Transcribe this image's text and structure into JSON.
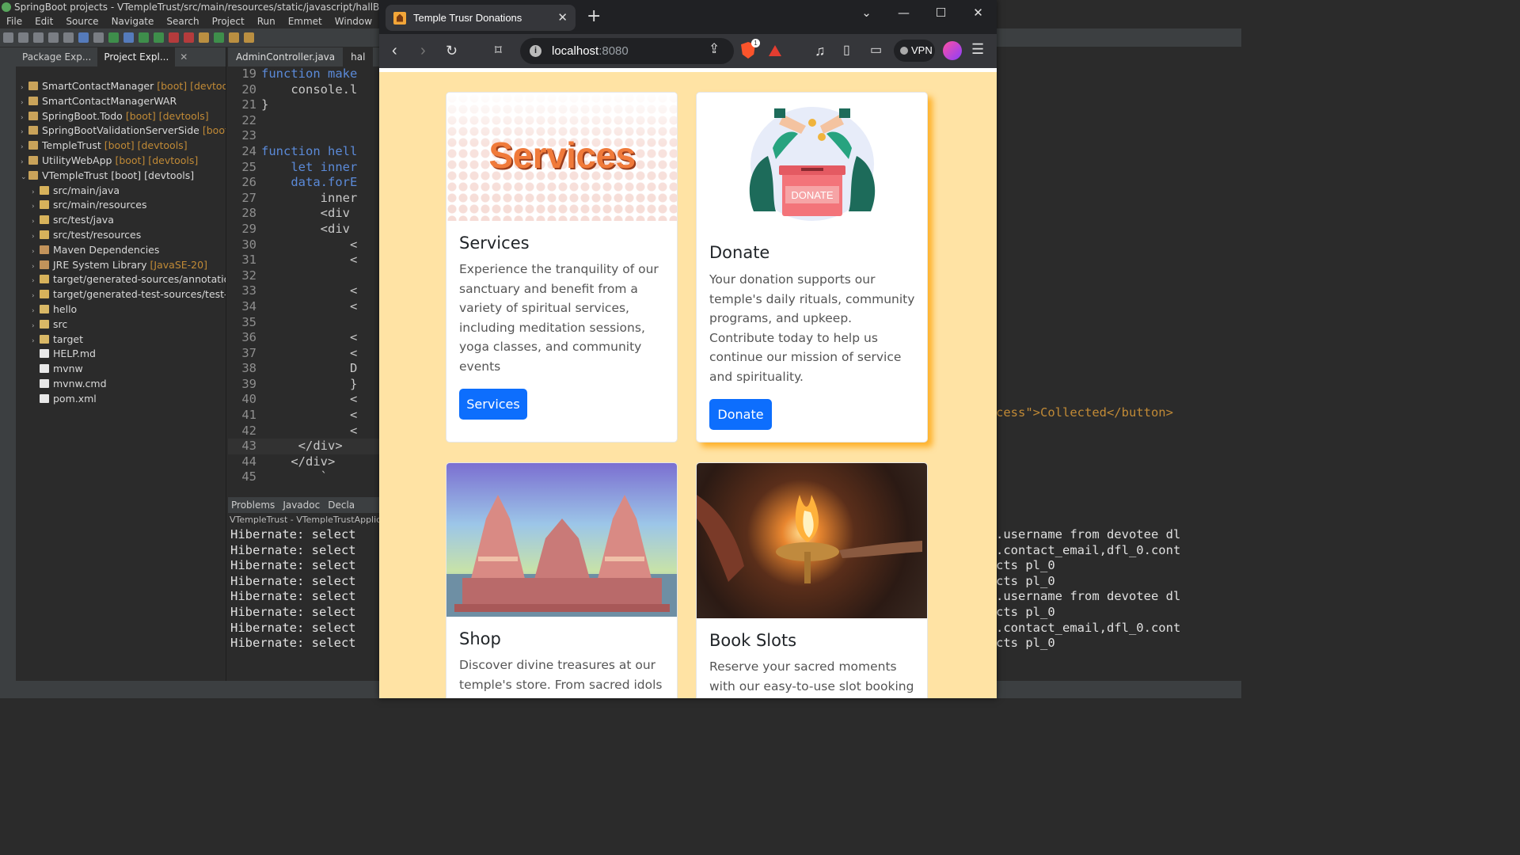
{
  "ide": {
    "title": "SpringBoot projects - VTempleTrust/src/main/resources/static/javascript/hallBooking.js - Sp",
    "menu": [
      "File",
      "Edit",
      "Source",
      "Navigate",
      "Search",
      "Project",
      "Run",
      "Emmet",
      "Window",
      "Help"
    ],
    "explorer_tabs": [
      "Package Exp...",
      "Project Expl..."
    ],
    "tree": [
      {
        "label": "SmartContactManager",
        "dec": "[boot] [devtools]",
        "depth": 0,
        "icon": "proj",
        "arrow": "›"
      },
      {
        "label": "SmartContactManagerWAR",
        "dec": "",
        "depth": 0,
        "icon": "proj",
        "arrow": "›"
      },
      {
        "label": "SpringBoot.Todo",
        "dec": "[boot] [devtools]",
        "depth": 0,
        "icon": "proj",
        "arrow": "›"
      },
      {
        "label": "SpringBootValidationServerSide",
        "dec": "[boot] [de",
        "depth": 0,
        "icon": "proj",
        "arrow": "›"
      },
      {
        "label": "TempleTrust",
        "dec": "[boot] [devtools]",
        "depth": 0,
        "icon": "proj",
        "arrow": "›"
      },
      {
        "label": "UtilityWebApp",
        "dec": "[boot] [devtools]",
        "depth": 0,
        "icon": "proj",
        "arrow": "›"
      },
      {
        "label": "VTempleTrust [boot] [devtools]",
        "dec": "",
        "depth": 0,
        "icon": "proj",
        "arrow": "⌄"
      },
      {
        "label": "src/main/java",
        "dec": "",
        "depth": 1,
        "icon": "pkg",
        "arrow": "›"
      },
      {
        "label": "src/main/resources",
        "dec": "",
        "depth": 1,
        "icon": "pkg",
        "arrow": "›"
      },
      {
        "label": "src/test/java",
        "dec": "",
        "depth": 1,
        "icon": "pkg",
        "arrow": "›"
      },
      {
        "label": "src/test/resources",
        "dec": "",
        "depth": 1,
        "icon": "pkg",
        "arrow": "›"
      },
      {
        "label": "Maven Dependencies",
        "dec": "",
        "depth": 1,
        "icon": "lib",
        "arrow": "›"
      },
      {
        "label": "JRE System Library",
        "dec": "[JavaSE-20]",
        "depth": 1,
        "icon": "lib",
        "arrow": "›"
      },
      {
        "label": "target/generated-sources/annotations",
        "dec": "",
        "depth": 1,
        "icon": "pkg",
        "arrow": "›"
      },
      {
        "label": "target/generated-test-sources/test-anno",
        "dec": "",
        "depth": 1,
        "icon": "pkg",
        "arrow": "›"
      },
      {
        "label": "hello",
        "dec": "",
        "depth": 1,
        "icon": "fld",
        "arrow": "›"
      },
      {
        "label": "src",
        "dec": "",
        "depth": 1,
        "icon": "fld",
        "arrow": "›"
      },
      {
        "label": "target",
        "dec": "",
        "depth": 1,
        "icon": "fld",
        "arrow": "›"
      },
      {
        "label": "HELP.md",
        "dec": "",
        "depth": 1,
        "icon": "file",
        "arrow": ""
      },
      {
        "label": "mvnw",
        "dec": "",
        "depth": 1,
        "icon": "file",
        "arrow": ""
      },
      {
        "label": "mvnw.cmd",
        "dec": "",
        "depth": 1,
        "icon": "file",
        "arrow": ""
      },
      {
        "label": "pom.xml",
        "dec": "",
        "depth": 1,
        "icon": "file",
        "arrow": ""
      }
    ],
    "editor_tabs": [
      "AdminController.java",
      "hal"
    ],
    "code": [
      {
        "n": "19",
        "t": "function make"
      },
      {
        "n": "20",
        "t": "    console.l"
      },
      {
        "n": "21",
        "t": "}"
      },
      {
        "n": "22",
        "t": ""
      },
      {
        "n": "23",
        "t": ""
      },
      {
        "n": "24",
        "t": "function hell"
      },
      {
        "n": "25",
        "t": "    let inner"
      },
      {
        "n": "26",
        "t": "    data.forE"
      },
      {
        "n": "27",
        "t": "        inner"
      },
      {
        "n": "28",
        "t": "        <div "
      },
      {
        "n": "29",
        "t": "        <div "
      },
      {
        "n": "30",
        "t": "            <"
      },
      {
        "n": "31",
        "t": "            <"
      },
      {
        "n": "32",
        "t": ""
      },
      {
        "n": "33",
        "t": "            <"
      },
      {
        "n": "34",
        "t": "            <"
      },
      {
        "n": "35",
        "t": ""
      },
      {
        "n": "36",
        "t": "            <"
      },
      {
        "n": "37",
        "t": "            <"
      },
      {
        "n": "38",
        "t": "            D"
      },
      {
        "n": "39",
        "t": "            }"
      },
      {
        "n": "40",
        "t": "            <"
      },
      {
        "n": "41",
        "t": "            <"
      },
      {
        "n": "42",
        "t": "            <"
      },
      {
        "n": "43",
        "t": "     </div>"
      },
      {
        "n": "44",
        "t": "    </div>"
      },
      {
        "n": "45",
        "t": "        `"
      }
    ],
    "console_tabs": [
      "Problems",
      "Javadoc",
      "Decla"
    ],
    "console_header": "VTempleTrust - VTempleTrustApplicati",
    "console_lines": [
      "Hibernate: select",
      "Hibernate: select",
      "Hibernate: select",
      "Hibernate: select",
      "Hibernate: select",
      "Hibernate: select",
      "Hibernate: select",
      "Hibernate: select"
    ],
    "right_code": "cess\">Collected</button>",
    "right_console": [
      ".username from devotee dl",
      ".contact_email,dfl_0.cont",
      "cts pl_0",
      "cts pl_0",
      ".username from devotee dl",
      "cts pl_0",
      ".contact_email,dfl_0.cont",
      "cts pl_0"
    ]
  },
  "browser": {
    "tab_title": "Temple Trusr Donations",
    "url_host": "localhost",
    "url_port": ":8080",
    "vpn_label": "VPN",
    "brave_badge": "1"
  },
  "cards": {
    "services": {
      "image_text": "Services",
      "title": "Services",
      "text": "Experience the tranquility of our sanctuary and benefit from a variety of spiritual services, including meditation sessions, yoga classes, and community events",
      "button": "Services"
    },
    "donate": {
      "image_text": "DONATE",
      "title": "Donate",
      "text": "Your donation supports our temple's daily rituals, community programs, and upkeep. Contribute today to help us continue our mission of service and spirituality.",
      "button": "Donate"
    },
    "shop": {
      "title": "Shop",
      "text": "Discover divine treasures at our temple's store. From sacred idols to"
    },
    "book_slots": {
      "title": "Book Slots",
      "text": "Reserve your sacred moments with our easy-to-use slot booking"
    }
  }
}
